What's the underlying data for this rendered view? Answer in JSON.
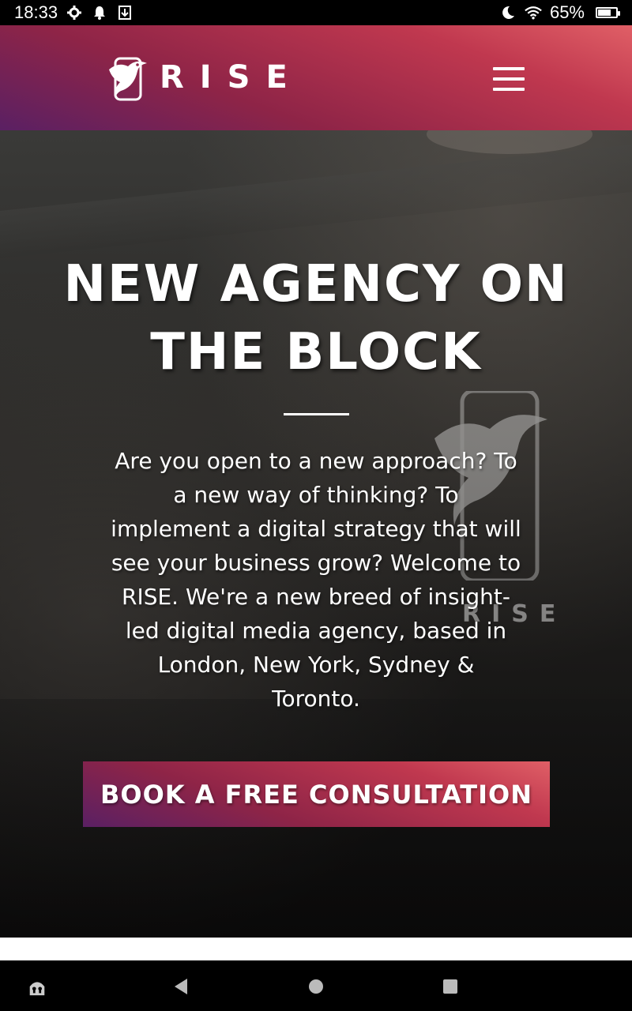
{
  "status_bar": {
    "time": "18:33",
    "battery_text": "65%",
    "battery_level": 0.65,
    "icons": [
      "settings-icon",
      "notification-icon",
      "download-icon",
      "do-not-disturb-icon",
      "wifi-icon",
      "battery-icon"
    ]
  },
  "header": {
    "logo_text": "RISE",
    "menu_icon": "hamburger-menu-icon"
  },
  "hero": {
    "title": "NEW AGENCY ON THE BLOCK",
    "body": "Are you open to a new approach? To a new way of thinking? To implement a digital strategy that will see your business grow? Welcome to RISE. We're a new breed of insight-led digital media agency, based in London, New York, Sydney & Toronto.",
    "cta_label": "BOOK A FREE CONSULTATION",
    "background_sign_text": "RISE"
  },
  "nav_bar": {
    "icons": [
      "accessibility-icon",
      "back-icon",
      "home-icon",
      "recents-icon"
    ]
  },
  "colors": {
    "gradient_start": "#5a2063",
    "gradient_mid": "#8e2447",
    "gradient_end": "#e05f66",
    "text": "#ffffff"
  }
}
